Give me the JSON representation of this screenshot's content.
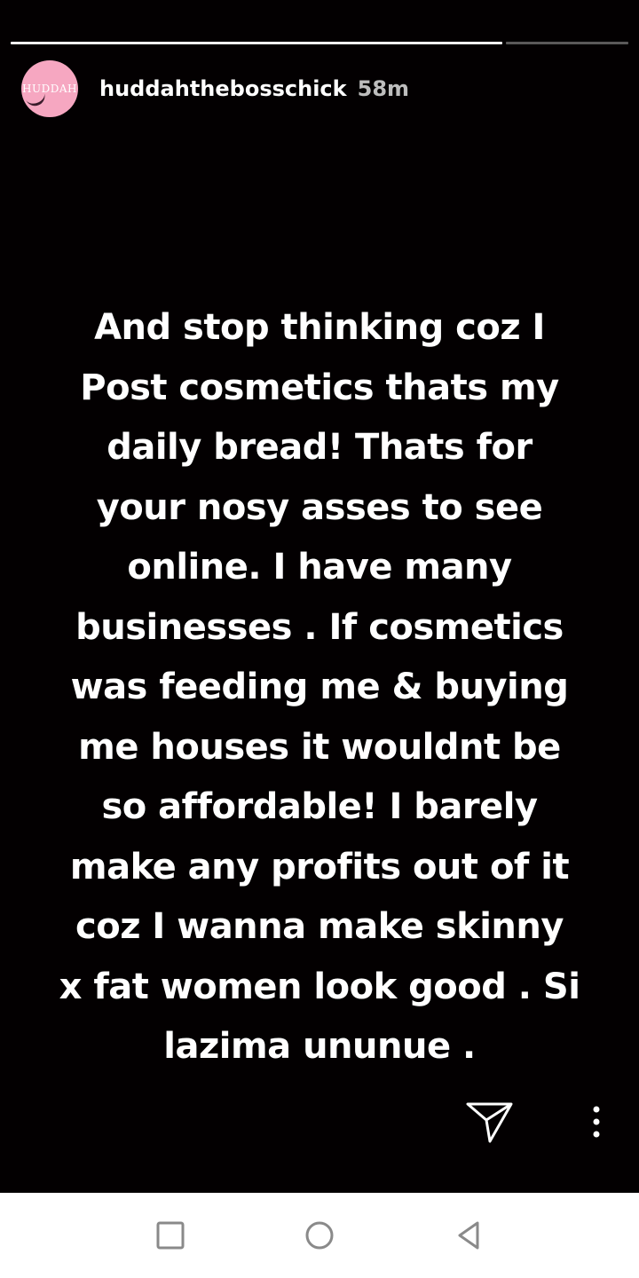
{
  "story": {
    "progress": {
      "total_segments": 1,
      "completed": 0.8
    },
    "user": {
      "avatar_text": "HUDDAH",
      "username": "huddahthebosschick",
      "time": "58m"
    },
    "text": "And stop thinking coz I\nPost cosmetics thats my\ndaily bread! Thats for\nyour nosy asses to see\nonline. I have many\nbusinesses . If cosmetics\nwas feeding me & buying\nme houses it wouldnt be\nso affordable! I barely\nmake any profits out of it\ncoz I wanna make skinny\nx fat women look good . Si\nlazima ununue .",
    "actions": {
      "send_icon": "paper-plane-icon",
      "more_icon": "vertical-dots-icon"
    }
  },
  "navbar": {
    "recents_icon": "square-icon",
    "home_icon": "circle-icon",
    "back_icon": "triangle-back-icon"
  },
  "colors": {
    "background": "#030001",
    "avatar": "#f6a7c1",
    "text": "#ffffff",
    "navbar": "#ffffff"
  }
}
